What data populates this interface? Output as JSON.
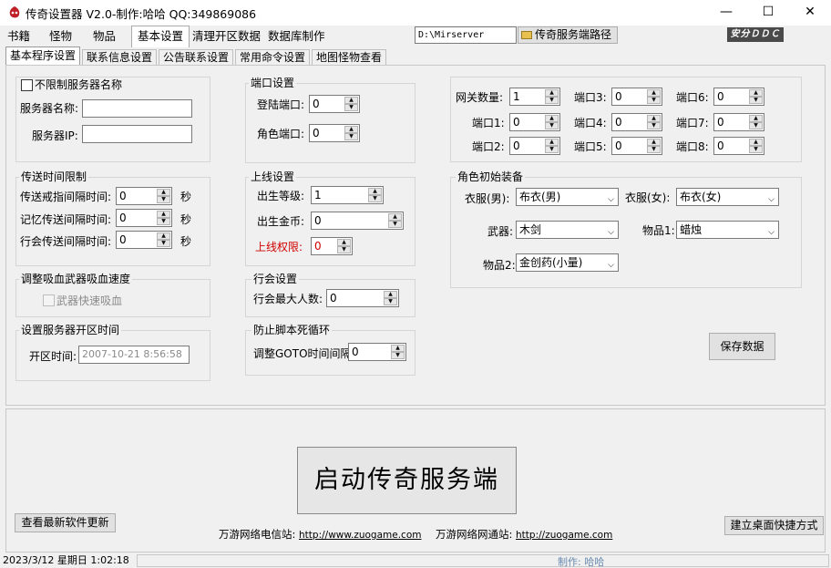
{
  "window": {
    "title": "传奇设置器 V2.0-制作:哈哈 QQ:349869086",
    "minimize": "—",
    "maximize": "☐",
    "close": "✕"
  },
  "main_tabs": [
    "书籍",
    "怪物",
    "物品",
    "基本设置",
    "清理开区数据",
    "数据库制作"
  ],
  "path": {
    "value": "D:\\Mirserver",
    "button_label": "传奇服务端路径"
  },
  "logo_text": "安分ＤＤＣ",
  "sub_tabs": [
    "基本程序设置",
    "联系信息设置",
    "公告联系设置",
    "常用命令设置",
    "地图怪物查看"
  ],
  "server_name_group": {
    "checkbox_label": "不限制服务器名称",
    "name_label": "服务器名称:",
    "name_value": "",
    "ip_label": "服务器IP:",
    "ip_value": ""
  },
  "ports_group": {
    "title": "端口设置",
    "login_label": "登陆端口:",
    "login_value": "0",
    "role_label": "角色端口:",
    "role_value": "0"
  },
  "gateway_group": {
    "count_label": "网关数量:",
    "count_value": "1",
    "ports": [
      {
        "label": "端口1:",
        "value": "0"
      },
      {
        "label": "端口2:",
        "value": "0"
      },
      {
        "label": "端口3:",
        "value": "0"
      },
      {
        "label": "端口4:",
        "value": "0"
      },
      {
        "label": "端口5:",
        "value": "0"
      },
      {
        "label": "端口6:",
        "value": "0"
      },
      {
        "label": "端口7:",
        "value": "0"
      },
      {
        "label": "端口8:",
        "value": "0"
      }
    ]
  },
  "teleport_group": {
    "title": "传送时间限制",
    "rows": [
      {
        "label": "传送戒指间隔时间:",
        "value": "0",
        "unit": "秒"
      },
      {
        "label": "记忆传送间隔时间:",
        "value": "0",
        "unit": "秒"
      },
      {
        "label": "行会传送间隔时间:",
        "value": "0",
        "unit": "秒"
      }
    ]
  },
  "online_group": {
    "title": "上线设置",
    "level_label": "出生等级:",
    "level_value": "1",
    "gold_label": "出生金币:",
    "gold_value": "0",
    "perm_label": "上线权限:",
    "perm_value": "0"
  },
  "equip_group": {
    "title": "角色初始装备",
    "male_label": "衣服(男):",
    "male_value": "布衣(男)",
    "female_label": "衣服(女):",
    "female_value": "布衣(女)",
    "weapon_label": "武器:",
    "weapon_value": "木剑",
    "item1_label": "物品1:",
    "item1_value": "蜡烛",
    "item2_label": "物品2:",
    "item2_value": "金创药(小量)"
  },
  "vamp_group": {
    "title": "调整吸血武器吸血速度",
    "checkbox_label": "武器快速吸血"
  },
  "guild_group": {
    "title": "行会设置",
    "max_label": "行会最大人数:",
    "max_value": "0"
  },
  "script_group": {
    "title": "防止脚本死循环",
    "goto_label": "调整GOTO时间间隔:",
    "goto_value": "0"
  },
  "open_time_group": {
    "title": "设置服务器开区时间",
    "label": "开区时间:",
    "value": "2007-10-21  8:56:58"
  },
  "save_button": "保存数据",
  "start_button": "启动传奇服务端",
  "check_update_button": "查看最新软件更新",
  "shortcut_button": "建立桌面快捷方式",
  "links": [
    {
      "prefix": "万游网络电信站:",
      "url": "http://www.zuogame.com"
    },
    {
      "prefix": "万游网络网通站:",
      "url": "http://zuogame.com"
    }
  ],
  "status": {
    "datetime": "2023/3/12  星期日  1:02:18",
    "author": "制作: 哈哈"
  },
  "colors": {
    "red": "#d00000",
    "panel_bg": "#f0f0f0"
  }
}
